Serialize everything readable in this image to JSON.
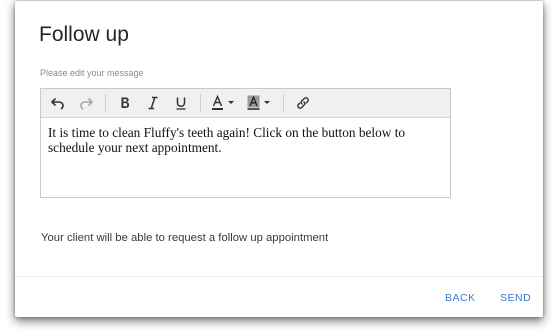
{
  "background": {
    "partial_text": ""
  },
  "dialog": {
    "title": "Follow up",
    "field_label": "Please edit your message",
    "editor": {
      "toolbar": [
        {
          "icon": "undo-icon"
        },
        {
          "icon": "redo-icon"
        },
        {
          "icon": "bold-icon"
        },
        {
          "icon": "italic-icon"
        },
        {
          "icon": "underline-icon"
        },
        {
          "icon": "text-color-icon"
        },
        {
          "icon": "background-color-icon"
        },
        {
          "icon": "link-icon"
        }
      ],
      "content": "It is time to clean Fluffy's teeth again!  Click on the button below to schedule your next appointment."
    },
    "helper_text": "Your client will be able to request a follow up appointment",
    "actions": {
      "back": "BACK",
      "send": "SEND"
    }
  },
  "colors": {
    "accent": "#2f7ecf"
  }
}
